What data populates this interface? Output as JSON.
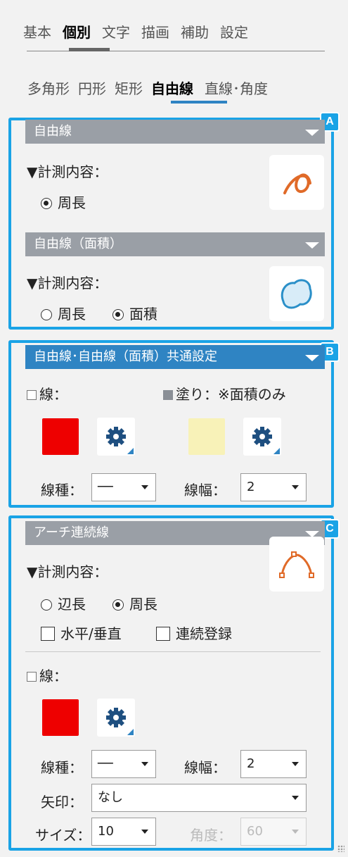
{
  "tabs_main": [
    {
      "label": "基本"
    },
    {
      "label": "個別"
    },
    {
      "label": "文字"
    },
    {
      "label": "描画"
    },
    {
      "label": "補助"
    },
    {
      "label": "設定"
    }
  ],
  "tabs_sub": [
    {
      "label": "多角形"
    },
    {
      "label": "円形"
    },
    {
      "label": "矩形"
    },
    {
      "label": "自由線"
    },
    {
      "label": "直線･角度"
    }
  ],
  "markers": {
    "a": "A",
    "b": "B",
    "c": "C"
  },
  "section_a": {
    "bar1": "自由線",
    "measure_label": "▼計測内容：",
    "option_perimeter": "周長",
    "bar2": "自由線（面積）",
    "measure_label2": "▼計測内容：",
    "option2_perimeter": "周長",
    "option2_area": "面積"
  },
  "section_b": {
    "bar": "自由線･自由線（面積）共通設定",
    "line_label": "線：",
    "fill_label": "塗り：※面積のみ",
    "linetype_label": "線種：",
    "linetype_value": "──",
    "linewidth_label": "線幅：",
    "linewidth_value": "2"
  },
  "section_c": {
    "bar": "アーチ連続線",
    "measure_label": "▼計測内容：",
    "option_side": "辺長",
    "option_perimeter": "周長",
    "check_hv": "水平/垂直",
    "check_continuous": "連続登録",
    "line_label": "線：",
    "linetype_label": "線種：",
    "linetype_value": "──",
    "linewidth_label": "線幅：",
    "linewidth_value": "2",
    "arrow_label": "矢印：",
    "arrow_value": "なし",
    "size_label": "サイズ：",
    "size_value": "10",
    "angle_label": "角度：",
    "angle_value": "60"
  },
  "colors": {
    "accent": "#1aa3e6",
    "red": "#ee0000",
    "cream": "#f8f2b8",
    "icon_orange": "#e06a28",
    "icon_blue": "#2a8fc8"
  }
}
